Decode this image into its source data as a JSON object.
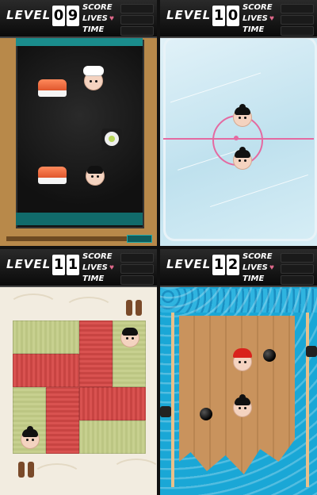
{
  "hud": {
    "level_label": "LEVEL",
    "score_label": "SCORE",
    "lives_label": "LIVES",
    "time_label": "TIME",
    "heart_icon": "♥"
  },
  "panels": [
    {
      "level_digits": [
        "0",
        "9"
      ],
      "theme": "sushi-board"
    },
    {
      "level_digits": [
        "1",
        "0"
      ],
      "theme": "ice-rink"
    },
    {
      "level_digits": [
        "1",
        "1"
      ],
      "theme": "tatami-room"
    },
    {
      "level_digits": [
        "1",
        "2"
      ],
      "theme": "wooden-ship"
    }
  ],
  "colors": {
    "heart": "#e06a8c",
    "rink_line": "#e46aa1",
    "tatami_red": "#d95250",
    "tatami_green": "#c7d08f",
    "sea": "#1aa7d6"
  }
}
